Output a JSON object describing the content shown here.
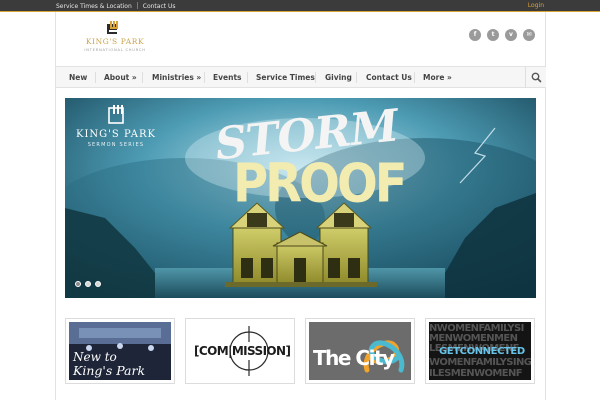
{
  "topbar": {
    "links": [
      "Service Times & Location",
      "Contact Us"
    ],
    "login": "Login"
  },
  "logo": {
    "name": "KING'S PARK",
    "subtitle": "INTERNATIONAL CHURCH"
  },
  "social": [
    {
      "icon": "facebook-icon",
      "glyph": "f"
    },
    {
      "icon": "twitter-icon",
      "glyph": "t"
    },
    {
      "icon": "vimeo-icon",
      "glyph": "v"
    },
    {
      "icon": "email-icon",
      "glyph": "✉"
    }
  ],
  "nav": {
    "items": [
      {
        "label": "New"
      },
      {
        "label": "About »"
      },
      {
        "label": "Ministries »"
      },
      {
        "label": "Events"
      },
      {
        "label": "Service Times"
      },
      {
        "label": "Giving"
      },
      {
        "label": "Contact Us"
      },
      {
        "label": "More »"
      }
    ],
    "search_icon": "search-icon"
  },
  "hero": {
    "series_name": "KING'S PARK",
    "series_sub": "SERMON SERIES",
    "title_line1": "STORM",
    "title_line2": "PROOF",
    "slide_count": 3,
    "active_slide": 1
  },
  "tiles": {
    "new_line1": "New to",
    "new_line2": "King's Park",
    "commission": "[COM|MISSION]",
    "city": "The City",
    "getconnected": "GETCONNECTED",
    "gc_bg_words": [
      "NWOMENFAMILYSI",
      "MENWOMENMEN",
      "LESMENWOMENF",
      "PSGETCONNECTED",
      "WOMENFAMILYSING",
      "ILESMENWOMENF"
    ]
  },
  "colors": {
    "accent_gold": "#d8a235",
    "topbar_bg": "#3b3b3b",
    "nav_bg": "#f6f6f6",
    "city_orange": "#f2a32b",
    "city_teal": "#4bbad0",
    "gc_blue": "#67c3e8"
  }
}
